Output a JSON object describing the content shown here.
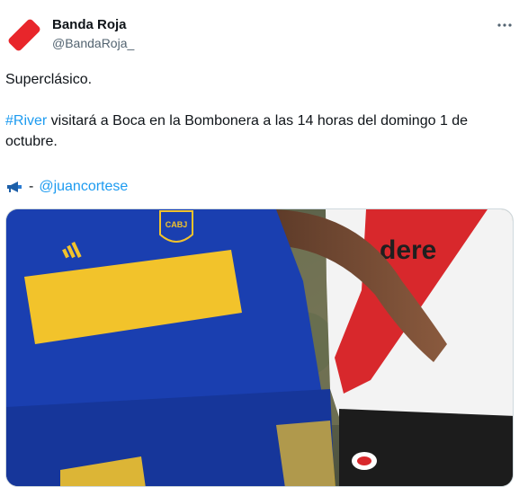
{
  "tweet": {
    "author": {
      "name": "Banda Roja",
      "handle": "@BandaRoja_",
      "avatar_icon": "red-slash-logo-icon"
    },
    "more_icon": "more-dots-icon",
    "lines": {
      "line1": "Superclásico.",
      "hashtag": "#River",
      "line2_rest": " visitará a Boca en la Bombonera a las 14 horas del domingo 1 de octubre.",
      "credit_icon": "megaphone-icon",
      "credit_dash": " - ",
      "mention": "@juancortese"
    },
    "media": {
      "description_icon": "football-players-photo",
      "shirt_text": "dere",
      "badge_text": "CABJ"
    },
    "colors": {
      "link": "#1d9bf0",
      "text": "#0f1419",
      "muted": "#536471",
      "brand_red": "#e8262b",
      "boca_blue": "#1a3fb0",
      "boca_yellow": "#f2c32b"
    }
  }
}
